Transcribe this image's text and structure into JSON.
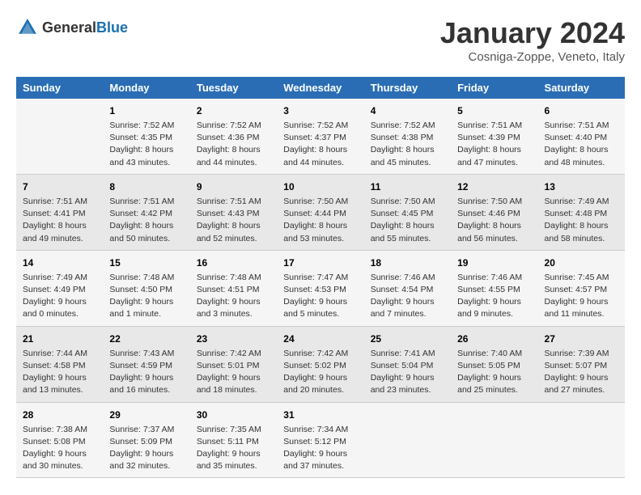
{
  "logo": {
    "text_general": "General",
    "text_blue": "Blue"
  },
  "header": {
    "title": "January 2024",
    "subtitle": "Cosniga-Zoppe, Veneto, Italy"
  },
  "days_of_week": [
    "Sunday",
    "Monday",
    "Tuesday",
    "Wednesday",
    "Thursday",
    "Friday",
    "Saturday"
  ],
  "weeks": [
    [
      {
        "day": "",
        "info": ""
      },
      {
        "day": "1",
        "info": "Sunrise: 7:52 AM\nSunset: 4:35 PM\nDaylight: 8 hours\nand 43 minutes."
      },
      {
        "day": "2",
        "info": "Sunrise: 7:52 AM\nSunset: 4:36 PM\nDaylight: 8 hours\nand 44 minutes."
      },
      {
        "day": "3",
        "info": "Sunrise: 7:52 AM\nSunset: 4:37 PM\nDaylight: 8 hours\nand 44 minutes."
      },
      {
        "day": "4",
        "info": "Sunrise: 7:52 AM\nSunset: 4:38 PM\nDaylight: 8 hours\nand 45 minutes."
      },
      {
        "day": "5",
        "info": "Sunrise: 7:51 AM\nSunset: 4:39 PM\nDaylight: 8 hours\nand 47 minutes."
      },
      {
        "day": "6",
        "info": "Sunrise: 7:51 AM\nSunset: 4:40 PM\nDaylight: 8 hours\nand 48 minutes."
      }
    ],
    [
      {
        "day": "7",
        "info": "Sunrise: 7:51 AM\nSunset: 4:41 PM\nDaylight: 8 hours\nand 49 minutes."
      },
      {
        "day": "8",
        "info": "Sunrise: 7:51 AM\nSunset: 4:42 PM\nDaylight: 8 hours\nand 50 minutes."
      },
      {
        "day": "9",
        "info": "Sunrise: 7:51 AM\nSunset: 4:43 PM\nDaylight: 8 hours\nand 52 minutes."
      },
      {
        "day": "10",
        "info": "Sunrise: 7:50 AM\nSunset: 4:44 PM\nDaylight: 8 hours\nand 53 minutes."
      },
      {
        "day": "11",
        "info": "Sunrise: 7:50 AM\nSunset: 4:45 PM\nDaylight: 8 hours\nand 55 minutes."
      },
      {
        "day": "12",
        "info": "Sunrise: 7:50 AM\nSunset: 4:46 PM\nDaylight: 8 hours\nand 56 minutes."
      },
      {
        "day": "13",
        "info": "Sunrise: 7:49 AM\nSunset: 4:48 PM\nDaylight: 8 hours\nand 58 minutes."
      }
    ],
    [
      {
        "day": "14",
        "info": "Sunrise: 7:49 AM\nSunset: 4:49 PM\nDaylight: 9 hours\nand 0 minutes."
      },
      {
        "day": "15",
        "info": "Sunrise: 7:48 AM\nSunset: 4:50 PM\nDaylight: 9 hours\nand 1 minute."
      },
      {
        "day": "16",
        "info": "Sunrise: 7:48 AM\nSunset: 4:51 PM\nDaylight: 9 hours\nand 3 minutes."
      },
      {
        "day": "17",
        "info": "Sunrise: 7:47 AM\nSunset: 4:53 PM\nDaylight: 9 hours\nand 5 minutes."
      },
      {
        "day": "18",
        "info": "Sunrise: 7:46 AM\nSunset: 4:54 PM\nDaylight: 9 hours\nand 7 minutes."
      },
      {
        "day": "19",
        "info": "Sunrise: 7:46 AM\nSunset: 4:55 PM\nDaylight: 9 hours\nand 9 minutes."
      },
      {
        "day": "20",
        "info": "Sunrise: 7:45 AM\nSunset: 4:57 PM\nDaylight: 9 hours\nand 11 minutes."
      }
    ],
    [
      {
        "day": "21",
        "info": "Sunrise: 7:44 AM\nSunset: 4:58 PM\nDaylight: 9 hours\nand 13 minutes."
      },
      {
        "day": "22",
        "info": "Sunrise: 7:43 AM\nSunset: 4:59 PM\nDaylight: 9 hours\nand 16 minutes."
      },
      {
        "day": "23",
        "info": "Sunrise: 7:42 AM\nSunset: 5:01 PM\nDaylight: 9 hours\nand 18 minutes."
      },
      {
        "day": "24",
        "info": "Sunrise: 7:42 AM\nSunset: 5:02 PM\nDaylight: 9 hours\nand 20 minutes."
      },
      {
        "day": "25",
        "info": "Sunrise: 7:41 AM\nSunset: 5:04 PM\nDaylight: 9 hours\nand 23 minutes."
      },
      {
        "day": "26",
        "info": "Sunrise: 7:40 AM\nSunset: 5:05 PM\nDaylight: 9 hours\nand 25 minutes."
      },
      {
        "day": "27",
        "info": "Sunrise: 7:39 AM\nSunset: 5:07 PM\nDaylight: 9 hours\nand 27 minutes."
      }
    ],
    [
      {
        "day": "28",
        "info": "Sunrise: 7:38 AM\nSunset: 5:08 PM\nDaylight: 9 hours\nand 30 minutes."
      },
      {
        "day": "29",
        "info": "Sunrise: 7:37 AM\nSunset: 5:09 PM\nDaylight: 9 hours\nand 32 minutes."
      },
      {
        "day": "30",
        "info": "Sunrise: 7:35 AM\nSunset: 5:11 PM\nDaylight: 9 hours\nand 35 minutes."
      },
      {
        "day": "31",
        "info": "Sunrise: 7:34 AM\nSunset: 5:12 PM\nDaylight: 9 hours\nand 37 minutes."
      },
      {
        "day": "",
        "info": ""
      },
      {
        "day": "",
        "info": ""
      },
      {
        "day": "",
        "info": ""
      }
    ]
  ]
}
